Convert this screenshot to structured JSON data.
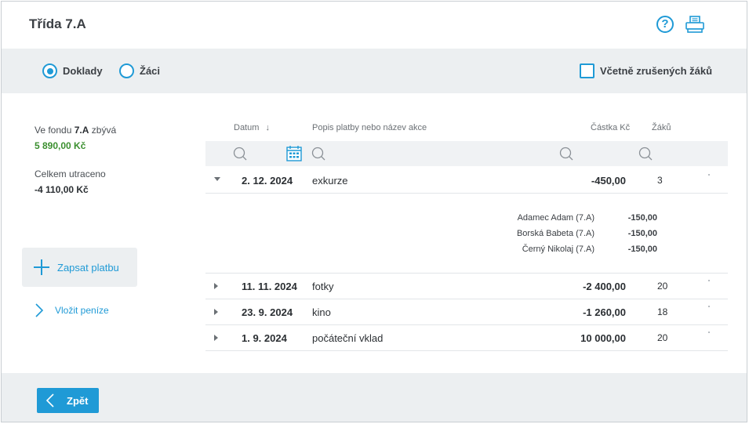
{
  "header": {
    "title": "Třída 7.A",
    "help_icon": "help-circle-icon",
    "print_icon": "printer-icon"
  },
  "filters": {
    "radio_documents": "Doklady",
    "radio_students": "Žáci",
    "selected": "Doklady",
    "checkbox_cancelled": "Včetně zrušených žáků",
    "checkbox_checked": false
  },
  "summary": {
    "fund_prefix": "Ve fondu",
    "fund_class": "7.A",
    "fund_suffix": "zbývá",
    "fund_value": "5 890,00 Kč",
    "spent_label": "Celkem utraceno",
    "spent_value": "-4 110,00 Kč"
  },
  "actions": {
    "add_payment": "Zapsat platbu",
    "deposit": "Vložit peníze",
    "back": "Zpět"
  },
  "table": {
    "headers": {
      "date": "Datum",
      "sort_arrow": "↓",
      "description": "Popis platby nebo název akce",
      "amount": "Částka Kč",
      "students": "Žáků"
    },
    "rows": [
      {
        "date": "2. 12. 2024",
        "description": "exkurze",
        "amount": "-450,00",
        "students": "3",
        "expanded": true
      },
      {
        "date": "11. 11. 2024",
        "description": "fotky",
        "amount": "-2 400,00",
        "students": "20",
        "expanded": false
      },
      {
        "date": "23. 9. 2024",
        "description": "kino",
        "amount": "-1 260,00",
        "students": "18",
        "expanded": false
      },
      {
        "date": "1. 9. 2024",
        "description": "počáteční vklad",
        "amount": "10 000,00",
        "students": "20",
        "expanded": false
      }
    ],
    "details": [
      {
        "name": "Adamec Adam (7.A)",
        "amount": "-150,00"
      },
      {
        "name": "Borská Babeta (7.A)",
        "amount": "-150,00"
      },
      {
        "name": "Černý Nikolaj (7.A)",
        "amount": "-150,00"
      }
    ]
  },
  "colors": {
    "accent": "#1f9ad6",
    "positive": "#3b8f2f",
    "panel": "#eceff1"
  }
}
